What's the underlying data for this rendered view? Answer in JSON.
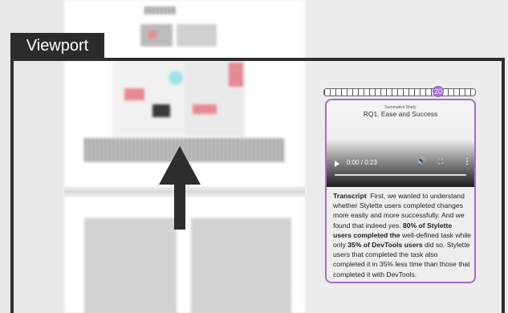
{
  "viewport": {
    "label": "Viewport"
  },
  "timeline": {
    "marker": "20"
  },
  "video": {
    "subtitle": "Summative Study",
    "title": "RQ1. Ease and Success",
    "time": "0:00 / 0:23"
  },
  "transcript": {
    "heading": "Transcript",
    "t1": "First, we wanted to understand whether Stylette users completed changes more easily and more successfully. And we found that indeed yes. ",
    "b1": "80% of Stylette users completed the",
    "t2": " well-defined task while only ",
    "b2": "35% of DevTools users",
    "t3": " did so. Stylette users that completed the task also completed it in 35% less time than those that completed it with DevTools."
  },
  "colors": {
    "accent": "#a36bd6",
    "frame": "#2e2e2e"
  },
  "icons": [
    "play-icon",
    "volume-icon",
    "fullscreen-icon",
    "more-options-icon",
    "up-arrow-icon"
  ]
}
